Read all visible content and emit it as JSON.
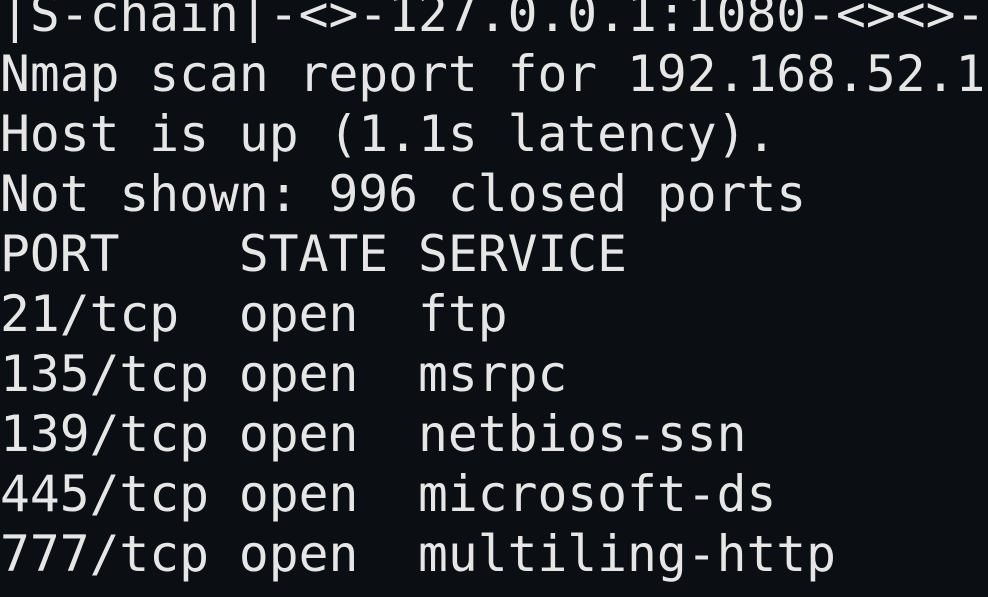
{
  "terminal": {
    "lines": [
      "|S-chain|-<>-127.0.0.1:1080-<><>-",
      "Nmap scan report for 192.168.52.1",
      "Host is up (1.1s latency).",
      "Not shown: 996 closed ports",
      "PORT    STATE SERVICE",
      "21/tcp  open  ftp",
      "135/tcp open  msrpc",
      "139/tcp open  netbios-ssn",
      "445/tcp open  microsoft-ds",
      "777/tcp open  multiling-http"
    ]
  },
  "colors": {
    "background": "#0b0f14",
    "text": "#e6e6e6"
  }
}
